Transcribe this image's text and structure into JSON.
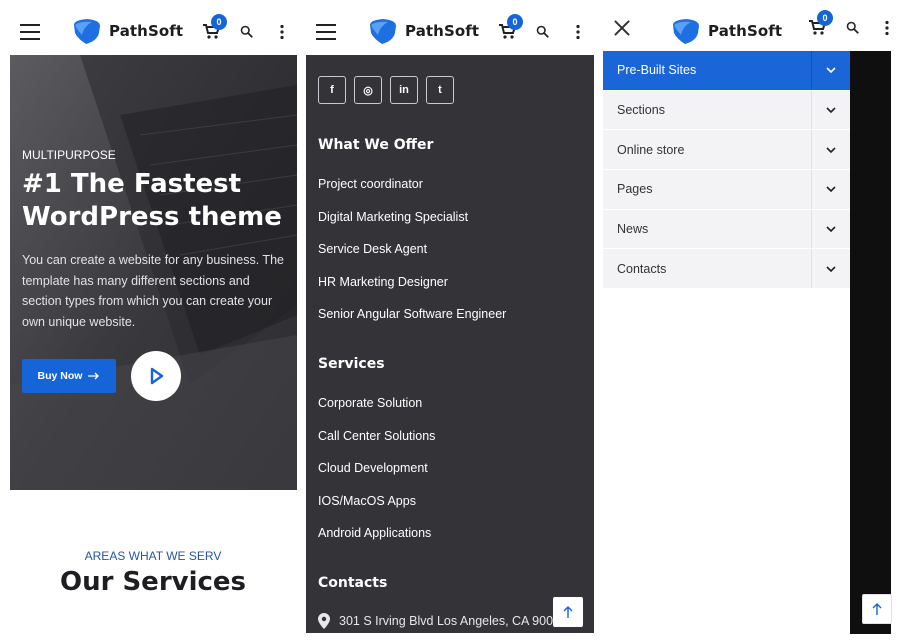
{
  "brand": {
    "name": "PathSoft",
    "accent": "#1565d8"
  },
  "header": {
    "cart_count": "0"
  },
  "hero": {
    "eyebrow": "MULTIPURPOSE",
    "title": "#1 The Fastest WordPress theme",
    "description": "You can create a website for any business. The template has many different sections and section types from which you can create your own unique website.",
    "cta_label": "Buy Now",
    "play_icon": "play-icon"
  },
  "services_section": {
    "eyebrow": "AREAS WHAT WE SERV",
    "title": "Our Services"
  },
  "footer": {
    "socials": [
      {
        "icon": "facebook-icon",
        "glyph": "f"
      },
      {
        "icon": "instagram-icon",
        "glyph": "◎"
      },
      {
        "icon": "linkedin-icon",
        "glyph": "in"
      },
      {
        "icon": "twitter-icon",
        "glyph": "t"
      }
    ],
    "what_we_offer": {
      "heading": "What We Offer",
      "items": [
        "Project coordinator",
        "Digital Marketing Specialist",
        "Service Desk Agent",
        "HR Marketing Designer",
        "Senior Angular Software Engineer"
      ]
    },
    "services": {
      "heading": "Services",
      "items": [
        "Corporate Solution",
        "Call Center Solutions",
        "Cloud Development",
        "IOS/MacOS Apps",
        "Android Applications"
      ]
    },
    "contacts": {
      "heading": "Contacts",
      "address": "301 S Irving Blvd Los Angeles, CA 90020"
    }
  },
  "mobile_menu": {
    "items": [
      {
        "label": "Pre-Built Sites",
        "active": true
      },
      {
        "label": "Sections",
        "active": false
      },
      {
        "label": "Online store",
        "active": false
      },
      {
        "label": "Pages",
        "active": false
      },
      {
        "label": "News",
        "active": false
      },
      {
        "label": "Contacts",
        "active": false
      }
    ]
  }
}
